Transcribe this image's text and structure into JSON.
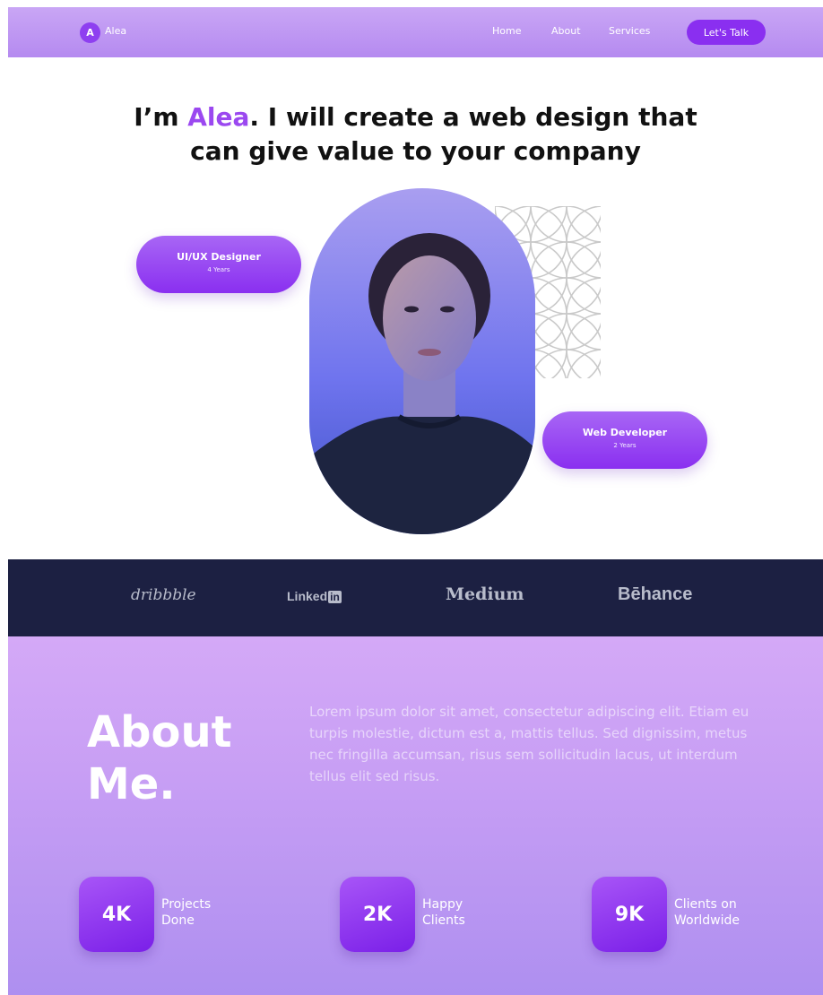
{
  "header": {
    "logo_initial": "A",
    "logo_text": "Alea",
    "nav": {
      "home": "Home",
      "about": "About",
      "services": "Services"
    },
    "cta_label": "Let's Talk"
  },
  "hero": {
    "title_prefix": "I’m ",
    "title_name": "Alea",
    "title_line1_suffix": ". I will create a web design that",
    "title_line2": "can give value to your company",
    "roles": [
      {
        "title": "UI/UX Designer",
        "years": "4 Years"
      },
      {
        "title": "Web Developer",
        "years": "2 Years"
      }
    ]
  },
  "brands": {
    "dribbble": "dribbble",
    "linkedin_text": "Linked",
    "linkedin_box": "in",
    "medium": "Medium",
    "behance": "Bēhance"
  },
  "about": {
    "title_line1": "About",
    "title_line2": "Me.",
    "text": "Lorem ipsum dolor sit amet, consectetur adipiscing elit. Etiam eu turpis molestie, dictum est a, mattis tellus. Sed dignissim, metus nec fringilla accumsan, risus sem sollicitudin lacus, ut interdum tellus elit sed risus.",
    "stats": [
      {
        "value": "4K",
        "label_line1": "Projects",
        "label_line2": "Done"
      },
      {
        "value": "2K",
        "label_line1": "Happy",
        "label_line2": "Clients"
      },
      {
        "value": "9K",
        "label_line1": "Clients on",
        "label_line2": "Worldwide"
      }
    ]
  },
  "colors": {
    "accent": "#9b48f0",
    "header_bg": "#c9a6f5",
    "brand_band": "#1c2042",
    "about_bg": "#d4a9f7"
  }
}
